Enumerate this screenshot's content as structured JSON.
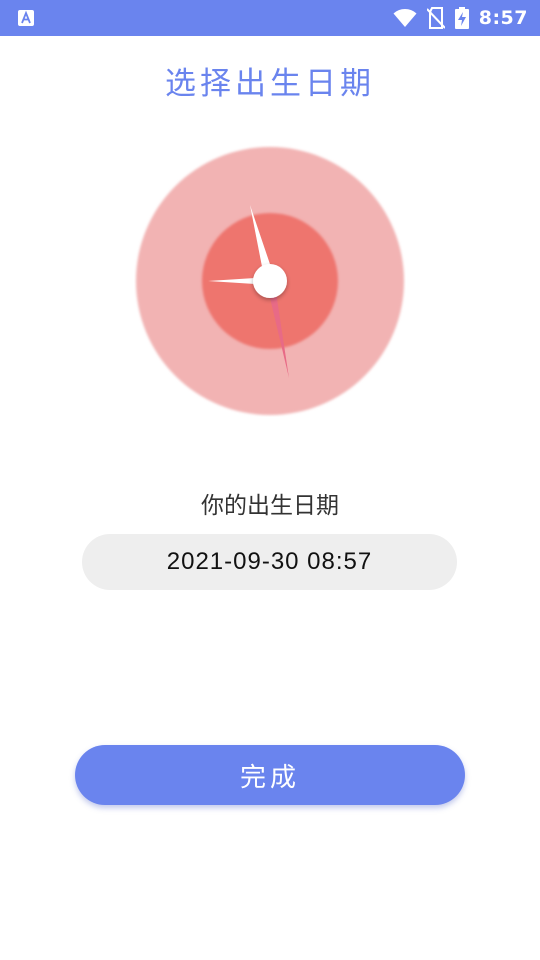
{
  "status_bar": {
    "time": "8:57",
    "left_icon": "accessibility-a-icon",
    "icons": [
      "wifi-icon",
      "no-sim-icon",
      "battery-charging-icon"
    ],
    "background": "#6a84ee"
  },
  "page": {
    "title": "选择出生日期"
  },
  "clock": {
    "display_time": "08:57",
    "outer_color": "#f2b3b3",
    "inner_color": "#ee756e"
  },
  "birth_date": {
    "label": "你的出生日期",
    "value": "2021-09-30 08:57"
  },
  "actions": {
    "done_label": "完成"
  },
  "colors": {
    "accent": "#6a84ee"
  }
}
